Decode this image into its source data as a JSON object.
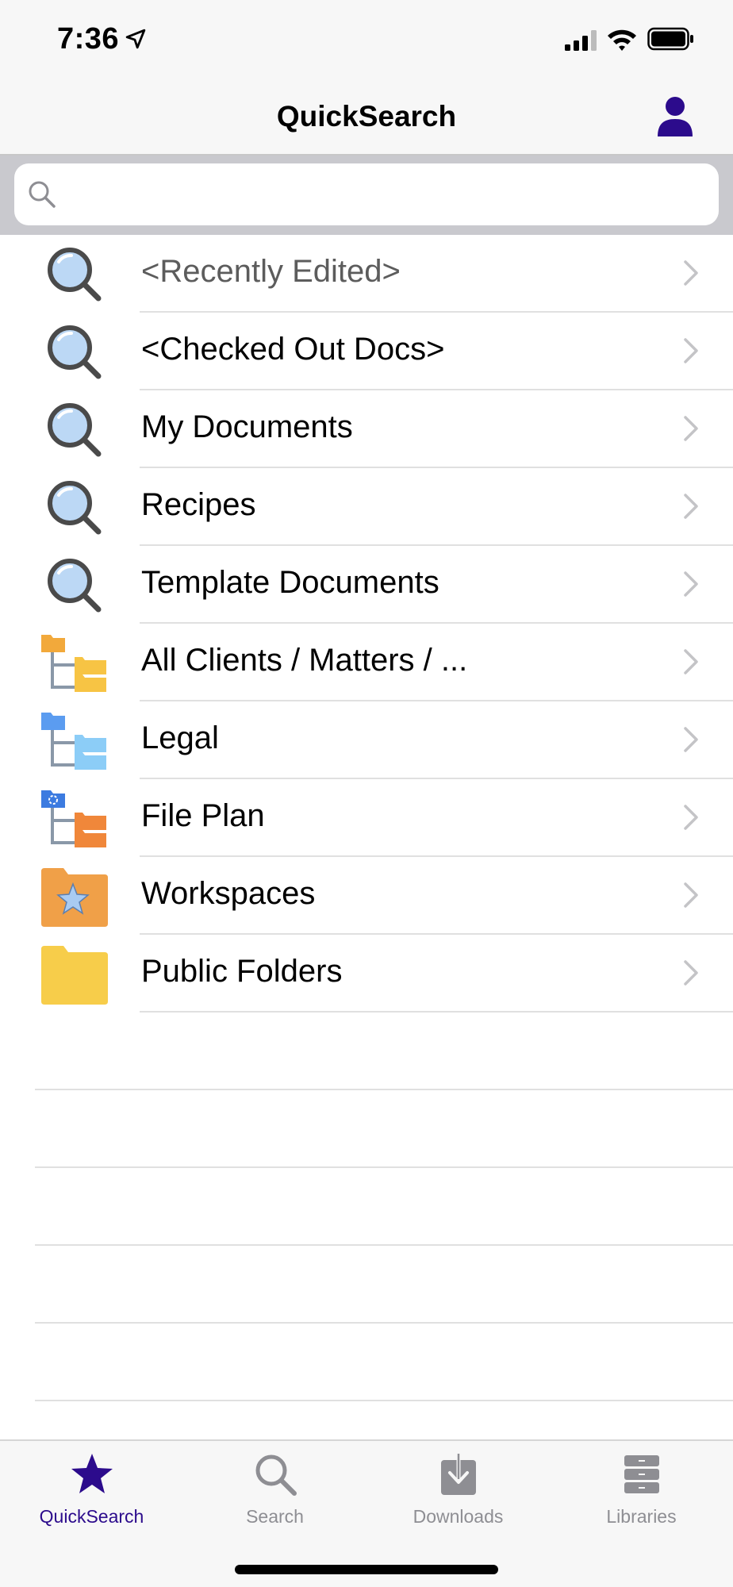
{
  "status": {
    "time": "7:36"
  },
  "nav": {
    "title": "QuickSearch"
  },
  "search": {
    "placeholder": ""
  },
  "items": [
    {
      "label": "<Recently Edited>",
      "icon": "magnifier-icon",
      "muted": true
    },
    {
      "label": "<Checked Out Docs>",
      "icon": "magnifier-icon"
    },
    {
      "label": "My Documents",
      "icon": "magnifier-icon"
    },
    {
      "label": "Recipes",
      "icon": "magnifier-icon"
    },
    {
      "label": "Template Documents",
      "icon": "magnifier-icon"
    },
    {
      "label": "All Clients / Matters / ...",
      "icon": "folder-tree-icon",
      "color": "#f2a93b"
    },
    {
      "label": "Legal",
      "icon": "folder-tree-icon",
      "color": "#5b9cf0"
    },
    {
      "label": "File Plan",
      "icon": "folder-tree-icon",
      "color": "#f0873a"
    },
    {
      "label": "Workspaces",
      "icon": "star-folder-icon",
      "color": "#f0a048"
    },
    {
      "label": "Public Folders",
      "icon": "folder-icon",
      "color": "#f7cd4a"
    }
  ],
  "tabs": [
    {
      "label": "QuickSearch",
      "icon": "star-icon",
      "active": true
    },
    {
      "label": "Search",
      "icon": "search-icon"
    },
    {
      "label": "Downloads",
      "icon": "download-icon"
    },
    {
      "label": "Libraries",
      "icon": "cabinet-icon"
    }
  ],
  "colors": {
    "accent": "#2c0b8c",
    "inactive": "#8e8e93"
  }
}
